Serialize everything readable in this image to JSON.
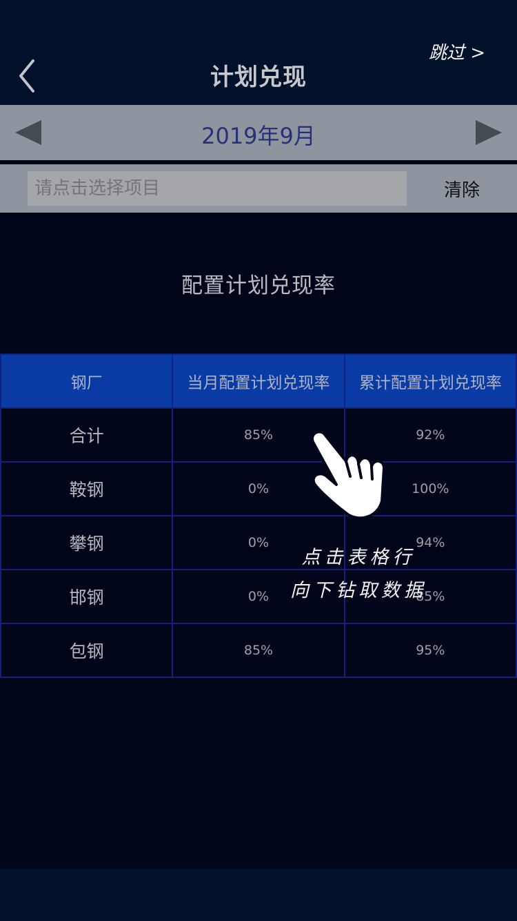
{
  "header": {
    "title": "计划兑现",
    "skip_label": "跳过 >",
    "back_icon": "chevron-left-icon"
  },
  "date_selector": {
    "value": "2019年9月",
    "prev_icon": "triangle-left-icon",
    "next_icon": "triangle-right-icon"
  },
  "filter": {
    "placeholder": "请点击选择项目",
    "clear_label": "清除"
  },
  "section": {
    "title": "配置计划兑现率"
  },
  "table": {
    "headers": [
      "钢厂",
      "当月配置计划兑现率",
      "累计配置计划兑现率"
    ],
    "rows": [
      {
        "name": "合计",
        "monthly": "85%",
        "cumulative": "92%"
      },
      {
        "name": "鞍钢",
        "monthly": "0%",
        "cumulative": "100%"
      },
      {
        "name": "攀钢",
        "monthly": "0%",
        "cumulative": "94%"
      },
      {
        "name": "邯钢",
        "monthly": "0%",
        "cumulative": "85%"
      },
      {
        "name": "包钢",
        "monthly": "85%",
        "cumulative": "95%"
      }
    ]
  },
  "guide": {
    "hint_line1": "点击表格行",
    "hint_line2": "向下钻取数据",
    "hand_icon": "pointing-hand-icon"
  },
  "colors": {
    "page_bg": "#00051a",
    "header_bg": "#01112a",
    "bar_bg": "#8f959f",
    "table_header_bg": "#0a3ba5",
    "table_border": "#14207e",
    "date_text": "#273178"
  }
}
